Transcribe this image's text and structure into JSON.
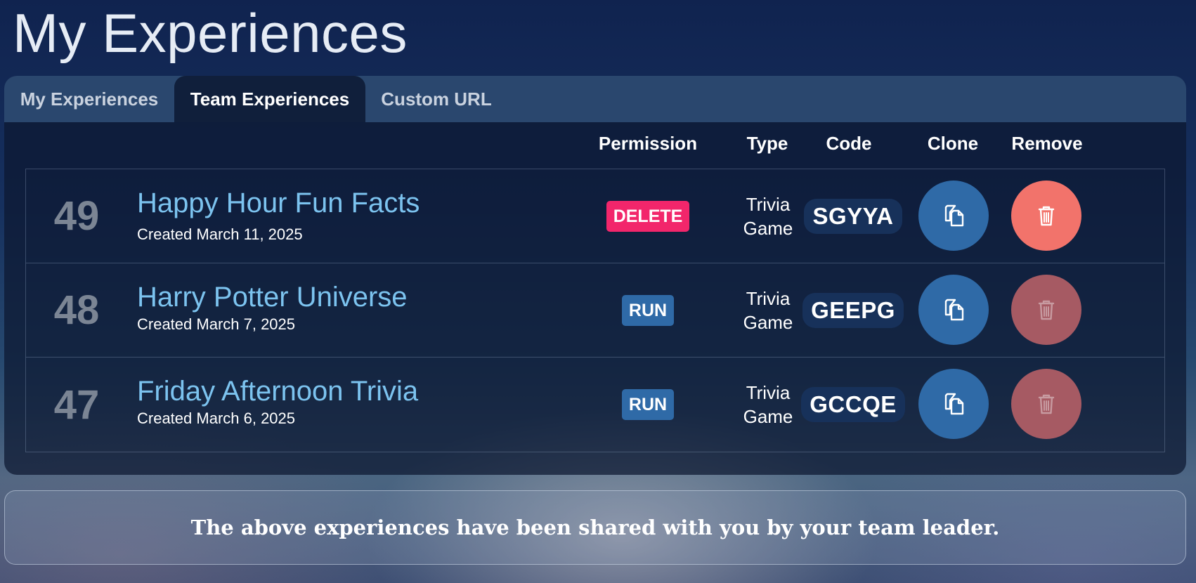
{
  "page": {
    "title": "My Experiences"
  },
  "tabs": [
    {
      "label": "My Experiences",
      "active": false
    },
    {
      "label": "Team Experiences",
      "active": true
    },
    {
      "label": "Custom URL",
      "active": false
    }
  ],
  "table": {
    "headers": {
      "permission": "Permission",
      "type": "Type",
      "code": "Code",
      "clone": "Clone",
      "remove": "Remove"
    },
    "rows": [
      {
        "number": "49",
        "title": "Happy Hour Fun Facts",
        "created": "Created March 11, 2025",
        "permission": "DELETE",
        "permission_color": "#f2266b",
        "type_line1": "Trivia",
        "type_line2": "Game",
        "code": "SGYYA",
        "clone_icon": "copy-icon",
        "remove_icon": "trash-icon",
        "remove_enabled": true
      },
      {
        "number": "48",
        "title": "Harry Potter Universe",
        "created": "Created March 7, 2025",
        "permission": "RUN",
        "permission_color": "#2f6aa7",
        "type_line1": "Trivia",
        "type_line2": "Game",
        "code": "GEEPG",
        "clone_icon": "copy-icon",
        "remove_icon": "trash-icon",
        "remove_enabled": false
      },
      {
        "number": "47",
        "title": "Friday Afternoon Trivia",
        "created": "Created March 6, 2025",
        "permission": "RUN",
        "permission_color": "#2f6aa7",
        "type_line1": "Trivia",
        "type_line2": "Game",
        "code": "GCCQE",
        "clone_icon": "copy-icon",
        "remove_icon": "trash-icon",
        "remove_enabled": false
      }
    ]
  },
  "note": {
    "text": "The above experiences have been shared with you by your team leader."
  },
  "colors": {
    "accent_blue": "#2f6aa7",
    "title_link": "#7cc3ef",
    "delete_badge": "#f2266b",
    "remove_active": "#f2736b",
    "remove_disabled": "#a65a63"
  }
}
